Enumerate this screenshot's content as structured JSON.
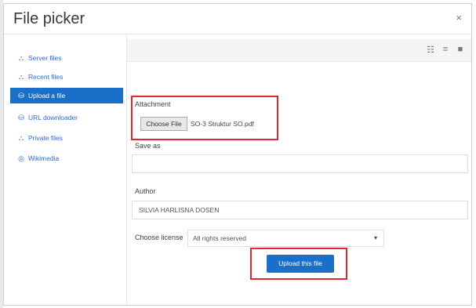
{
  "dialog": {
    "title": "File picker",
    "close_glyph": "×"
  },
  "sidebar": {
    "items": [
      {
        "label": "Server files",
        "icon": "server-files-icon",
        "glyph": "⛬"
      },
      {
        "label": "Recent files",
        "icon": "recent-files-icon",
        "glyph": "⛬"
      },
      {
        "label": "Upload a file",
        "icon": "upload-icon",
        "glyph": "⛁",
        "active": true
      },
      {
        "label": "URL downloader",
        "icon": "url-downloader-icon",
        "glyph": "⛁"
      },
      {
        "label": "Private files",
        "icon": "private-files-icon",
        "glyph": "⛬"
      },
      {
        "label": "Wikimedia",
        "icon": "wikimedia-icon",
        "glyph": "◎"
      }
    ]
  },
  "toolbar": {
    "view_icons": [
      "☷",
      "≡",
      "■"
    ]
  },
  "form": {
    "attachment_label": "Attachment",
    "choose_file_label": "Choose File",
    "file_name": "SO-3 Struktur SO.pdf",
    "save_as_label": "Save as",
    "save_as_value": "",
    "author_label": "Author",
    "author_value": "SILVIA HARLISNA DOSEN",
    "license_label": "Choose license",
    "license_value": "All rights reserved",
    "license_caret": "▾",
    "upload_button_label": "Upload this file"
  },
  "colors": {
    "accent": "#1a6fc9",
    "highlight": "#e1262d",
    "link": "#2a6ad0"
  }
}
